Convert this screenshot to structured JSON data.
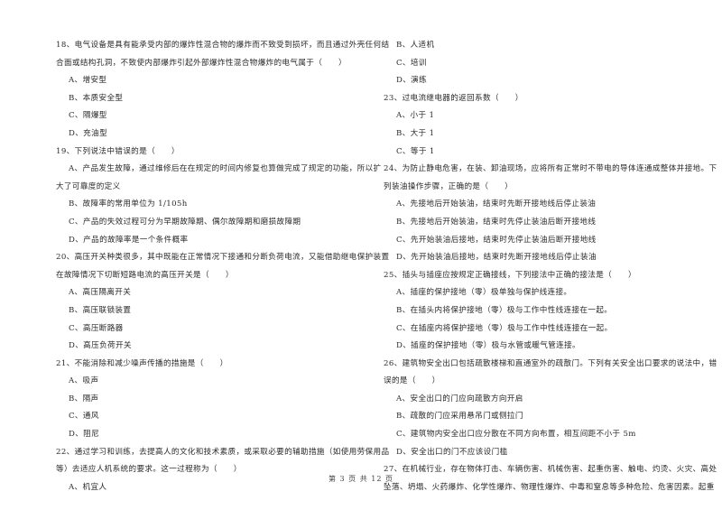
{
  "left_column": [
    {
      "type": "q",
      "text": "18、电气设备是具有能承受内部的爆炸性混合物的爆炸而不致受到损坏，而且通过外壳任何结"
    },
    {
      "type": "q",
      "text": "合面或结构孔洞，不致使内部爆炸引起外部爆炸性混合物爆炸的电气属于（　　）"
    },
    {
      "type": "opt",
      "text": "A、增安型"
    },
    {
      "type": "opt",
      "text": "B、本质安全型"
    },
    {
      "type": "opt",
      "text": "C、隔爆型"
    },
    {
      "type": "opt",
      "text": "D、充油型"
    },
    {
      "type": "q",
      "text": "19、下列说法中错误的是（　　）"
    },
    {
      "type": "opt",
      "text": "A、产品发生故障，通过维修后在在规定的时间内修复也算做完成了规定的功能，所以扩"
    },
    {
      "type": "q",
      "text": "大了可靠度的定义"
    },
    {
      "type": "opt",
      "text": "B、故障率的常用单位为 1/105h"
    },
    {
      "type": "opt",
      "text": "C、产品的失效过程可分为早期故障期、偶尔故障期和磨损故障期"
    },
    {
      "type": "opt",
      "text": "D、产品的故障率是一个条件概率"
    },
    {
      "type": "q",
      "text": "20、高压开关种类很多，其中既能在正常情况下接通和分断负荷电流，又能借助继电保护装置"
    },
    {
      "type": "q",
      "text": "在故障情况下切断短路电流的高压开关是（　　）"
    },
    {
      "type": "opt",
      "text": "A、高压隔离开关"
    },
    {
      "type": "opt",
      "text": "B、高压联锁装置"
    },
    {
      "type": "opt",
      "text": "C、高压断路器"
    },
    {
      "type": "opt",
      "text": "D、高压负荷开关"
    },
    {
      "type": "q",
      "text": "21、不能消除和减少噪声传播的措施是（　　）"
    },
    {
      "type": "opt",
      "text": "A、吸声"
    },
    {
      "type": "opt",
      "text": "B、隔声"
    },
    {
      "type": "opt",
      "text": "C、通风"
    },
    {
      "type": "opt",
      "text": "D、阻尼"
    },
    {
      "type": "q",
      "text": "22、通过学习和训练，去提高人的文化和技术素质，或采取必要的辅助措施（如使用劳保用品"
    },
    {
      "type": "q",
      "text": "等）去适应人机系统的要求。这一过程称为（　　）"
    },
    {
      "type": "opt",
      "text": "A、机宜人"
    }
  ],
  "right_column": [
    {
      "type": "opt",
      "text": "B、人适机"
    },
    {
      "type": "opt",
      "text": "C、培训"
    },
    {
      "type": "opt",
      "text": "D、演练"
    },
    {
      "type": "q",
      "text": "23、过电流继电器的返回系数（　　）"
    },
    {
      "type": "opt",
      "text": "A、小于 1"
    },
    {
      "type": "opt",
      "text": "B、大于 1"
    },
    {
      "type": "opt",
      "text": "C、等于 1"
    },
    {
      "type": "q",
      "text": "24、为防止静电危害，在装、卸油现场，应将所有正常时不带电的导体连通成整体并接地。下"
    },
    {
      "type": "q",
      "text": "列装油操作步骤，正确的是（　　）"
    },
    {
      "type": "opt",
      "text": "A、先接地后开始装油，结束时先断开接地线后停止装油"
    },
    {
      "type": "opt",
      "text": "B、先接地后开始装油，结束时先停止装油后断开接地线"
    },
    {
      "type": "opt",
      "text": "C、先开始装油后接地，结束时先停止装油后断开接地线"
    },
    {
      "type": "opt",
      "text": "D、先开始装油后接地，结束时先断开接地线后停止装油"
    },
    {
      "type": "q",
      "text": "25、插头与插座应按规定正确接线，下列接法中正确的接法是（　　）"
    },
    {
      "type": "opt",
      "text": "A、插座的保护接地（零）极单独与保护线连接。"
    },
    {
      "type": "opt",
      "text": "B、在插头内将保护接地（零）极与工作中性线连接在一起。"
    },
    {
      "type": "opt",
      "text": "C、在插座内将保护接地（零）极与工作中性线连接在一起。"
    },
    {
      "type": "opt",
      "text": "D、插座的保护接地（零）极与水管或暖气管连接。"
    },
    {
      "type": "q",
      "text": "26、建筑物安全出口包括疏散楼梯和直通室外的疏散门。下列有关安全出口要求的说法中，错"
    },
    {
      "type": "q",
      "text": "误的是（　　）"
    },
    {
      "type": "opt",
      "text": "A、安全出口的门应向疏散方向开启"
    },
    {
      "type": "opt",
      "text": "B、疏散的门应采用悬吊门或侧拉门"
    },
    {
      "type": "opt",
      "text": "C、建筑物内安全出口应分散在不同方向布置，相互间距不小于 5m"
    },
    {
      "type": "opt",
      "text": "D、安全出口的门不应该设门槛"
    },
    {
      "type": "q",
      "text": "27、在机械行业，存在物体打击、车辆伤害、机械伤害、起重伤害、触电、灼烫、火灾、高处"
    },
    {
      "type": "q",
      "text": "坠落、坍塌、火药爆炸、化学性爆炸、物理性爆炸、中毒和窒息等多种危险、危害因素。起重"
    }
  ],
  "footer": {
    "page_label": "第 3 页 共 12 页"
  }
}
